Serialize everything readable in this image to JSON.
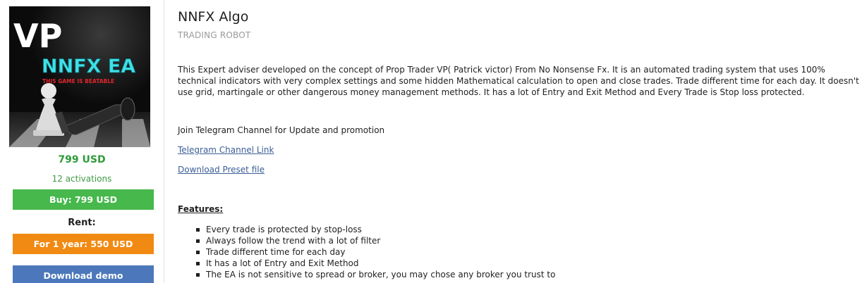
{
  "product": {
    "image": {
      "logo_text_vp": "VP",
      "logo_text_ea": "NNFX EA",
      "tagline": "THIS GAME IS BEATABLE"
    },
    "price": "799 USD",
    "activations": "12 activations",
    "buy_label": "Buy: 799 USD",
    "rent_label": "Rent:",
    "rent_option_label": "For 1 year: 550 USD",
    "demo_label": "Download demo"
  },
  "main": {
    "title": "NNFX Algo",
    "subtitle": "TRADING ROBOT",
    "description": "This Expert adviser developed on the concept of Prop Trader VP( Patrick victor) From No Nonsense Fx. It is an automated trading system that uses 100% technical indicators with very complex settings and some hidden Mathematical calculation to open and close trades. Trade different time for each day. It doesn't use grid, martingale or other dangerous money management methods. It has a lot of Entry and Exit Method and Every Trade is Stop loss protected.",
    "telegram_text": "Join Telegram Channel for Update and promotion",
    "telegram_link": "Telegram Channel Link",
    "preset_link": "Download Preset file ",
    "features_heading": "Features:",
    "features": [
      "Every trade is protected by stop-loss",
      "Always follow the trend with a lot of filter",
      "Trade different time for each day",
      "It has a lot of Entry and Exit Method",
      "The EA is not sensitive to spread or broker, you may chose any broker you trust to"
    ]
  },
  "colors": {
    "price_green": "#2e9b3a",
    "buy_green": "#46b84c",
    "rent_orange": "#f18a12",
    "demo_blue": "#4c78bb",
    "link_blue": "#3b5e96",
    "logo_cyan": "#3fe0e8",
    "tagline_red": "#e0262b"
  }
}
